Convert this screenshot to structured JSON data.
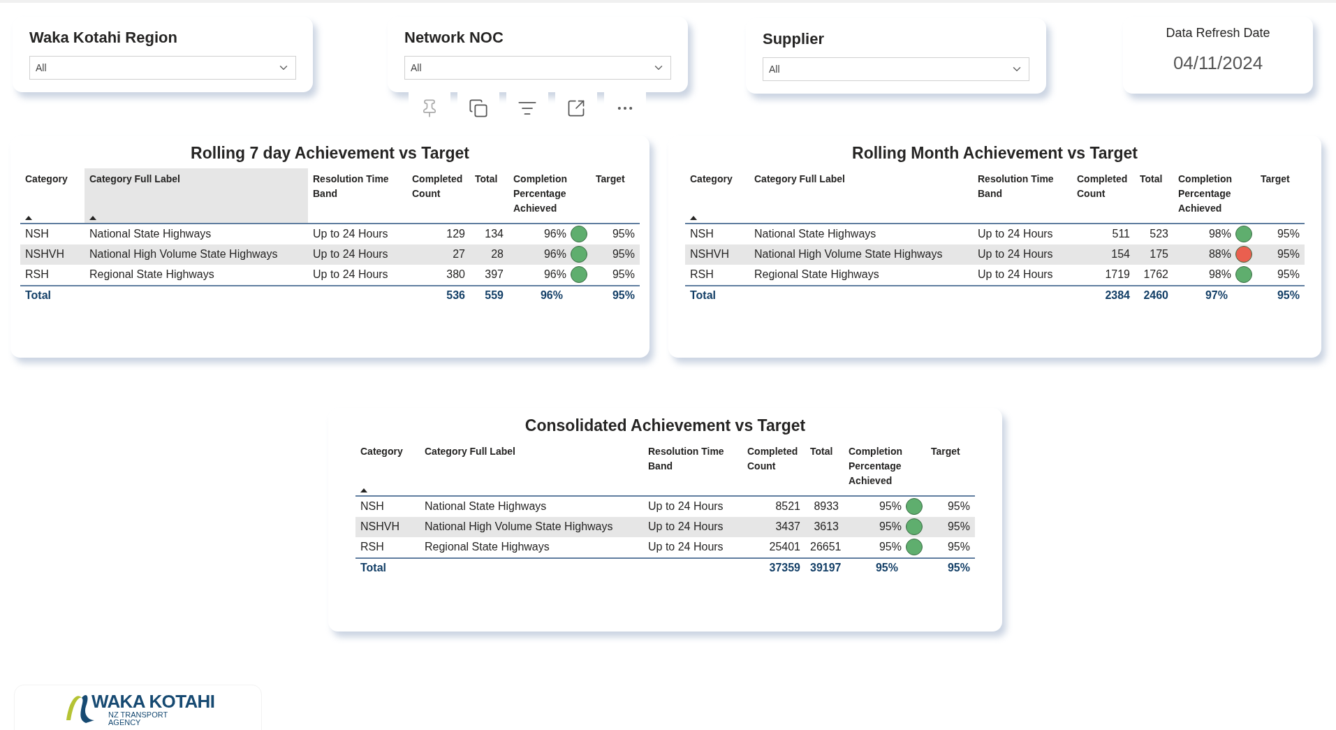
{
  "filters": [
    {
      "title": "Waka Kotahi Region",
      "value": "All"
    },
    {
      "title": "Network NOC",
      "value": "All"
    },
    {
      "title": "Supplier",
      "value": "All"
    }
  ],
  "refresh": {
    "label": "Data Refresh Date",
    "date": "04/11/2024"
  },
  "tables": [
    {
      "title": "Rolling 7 day Achievement vs Target",
      "columns": [
        {
          "label": "Category",
          "sorted": true,
          "highlighted": false
        },
        {
          "label": "Category Full Label",
          "sorted": true,
          "highlighted": true
        },
        {
          "label": "Resolution Time Band",
          "sorted": false,
          "highlighted": false
        },
        {
          "label": "Completed Count",
          "sorted": false,
          "highlighted": false
        },
        {
          "label": "Total",
          "sorted": false,
          "highlighted": false
        },
        {
          "label": "Completion Percentage Achieved",
          "sorted": false,
          "highlighted": false
        },
        {
          "label": "Target",
          "sorted": false,
          "highlighted": false
        }
      ],
      "rows": [
        {
          "category": "NSH",
          "full_label": "National State Highways",
          "band": "Up to 24 Hours",
          "completed": "129",
          "total": "134",
          "percentage": "96%",
          "color": "#5fae6e",
          "target": "95%"
        },
        {
          "category": "NSHVH",
          "full_label": "National High Volume State Highways",
          "band": "Up to 24 Hours",
          "completed": "27",
          "total": "28",
          "percentage": "96%",
          "color": "#5fae6e",
          "target": "95%"
        },
        {
          "category": "RSH",
          "full_label": "Regional State Highways",
          "band": "Up to 24 Hours",
          "completed": "380",
          "total": "397",
          "percentage": "96%",
          "color": "#5fae6e",
          "target": "95%"
        }
      ],
      "total": {
        "label": "Total",
        "completed": "536",
        "total": "559",
        "percentage": "96%",
        "target": "95%"
      }
    },
    {
      "title": "Rolling Month Achievement vs Target",
      "columns": [
        {
          "label": "Category",
          "sorted": true,
          "highlighted": false
        },
        {
          "label": "Category Full Label",
          "sorted": false,
          "highlighted": false
        },
        {
          "label": "Resolution Time Band",
          "sorted": false,
          "highlighted": false
        },
        {
          "label": "Completed Count",
          "sorted": false,
          "highlighted": false
        },
        {
          "label": "Total",
          "sorted": false,
          "highlighted": false
        },
        {
          "label": "Completion Percentage Achieved",
          "sorted": false,
          "highlighted": false
        },
        {
          "label": "Target",
          "sorted": false,
          "highlighted": false
        }
      ],
      "rows": [
        {
          "category": "NSH",
          "full_label": "National State Highways",
          "band": "Up to 24 Hours",
          "completed": "511",
          "total": "523",
          "percentage": "98%",
          "color": "#5fae6e",
          "target": "95%"
        },
        {
          "category": "NSHVH",
          "full_label": "National High Volume State Highways",
          "band": "Up to 24 Hours",
          "completed": "154",
          "total": "175",
          "percentage": "88%",
          "color": "#ea5f4f",
          "target": "95%"
        },
        {
          "category": "RSH",
          "full_label": "Regional State Highways",
          "band": "Up to 24 Hours",
          "completed": "1719",
          "total": "1762",
          "percentage": "98%",
          "color": "#5fae6e",
          "target": "95%"
        }
      ],
      "total": {
        "label": "Total",
        "completed": "2384",
        "total": "2460",
        "percentage": "97%",
        "target": "95%"
      }
    },
    {
      "title": "Consolidated Achievement vs Target",
      "columns": [
        {
          "label": "Category",
          "sorted": true,
          "highlighted": false
        },
        {
          "label": "Category Full Label",
          "sorted": false,
          "highlighted": false
        },
        {
          "label": "Resolution Time Band",
          "sorted": false,
          "highlighted": false
        },
        {
          "label": "Completed Count",
          "sorted": false,
          "highlighted": false
        },
        {
          "label": "Total",
          "sorted": false,
          "highlighted": false
        },
        {
          "label": "Completion Percentage Achieved",
          "sorted": false,
          "highlighted": false
        },
        {
          "label": "Target",
          "sorted": false,
          "highlighted": false
        }
      ],
      "rows": [
        {
          "category": "NSH",
          "full_label": "National State Highways",
          "band": "Up to 24 Hours",
          "completed": "8521",
          "total": "8933",
          "percentage": "95%",
          "color": "#5fae6e",
          "target": "95%"
        },
        {
          "category": "NSHVH",
          "full_label": "National High Volume State Highways",
          "band": "Up to 24 Hours",
          "completed": "3437",
          "total": "3613",
          "percentage": "95%",
          "color": "#5fae6e",
          "target": "95%"
        },
        {
          "category": "RSH",
          "full_label": "Regional State Highways",
          "band": "Up to 24 Hours",
          "completed": "25401",
          "total": "26651",
          "percentage": "95%",
          "color": "#5fae6e",
          "target": "95%"
        }
      ],
      "total": {
        "label": "Total",
        "completed": "37359",
        "total": "39197",
        "percentage": "95%",
        "target": "95%"
      }
    }
  ],
  "logo": {
    "name": "WAKA KOTAHI",
    "line_1": "NZ TRANSPORT",
    "line_2": "AGENCY"
  }
}
